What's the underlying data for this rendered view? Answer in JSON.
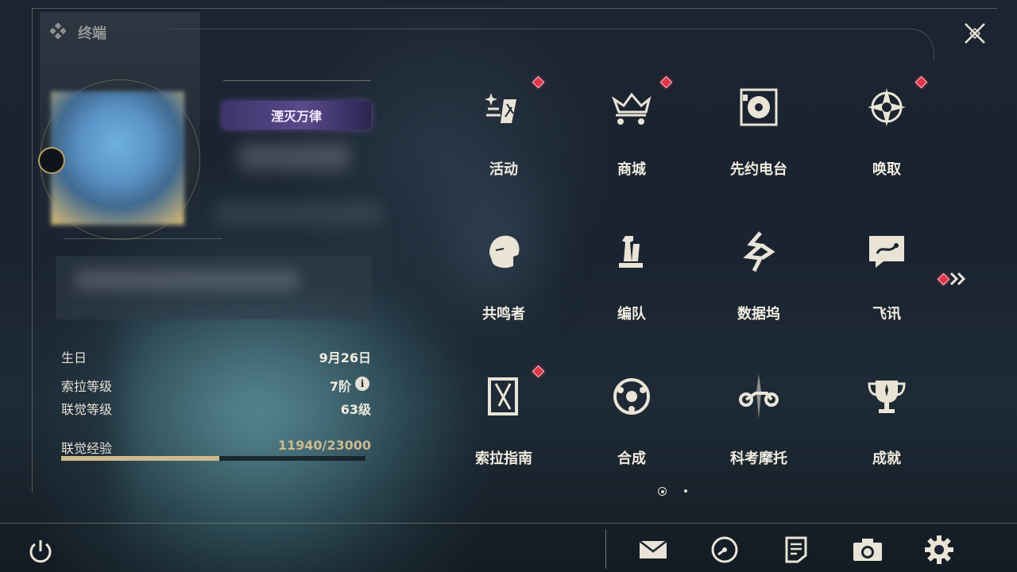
{
  "header": {
    "title": "终端"
  },
  "profile": {
    "title_badge": "湮灭万律"
  },
  "stats": [
    {
      "label": "生日",
      "value": "9月26日"
    },
    {
      "label": "索拉等级",
      "value": "7阶"
    },
    {
      "label": "联觉等级",
      "value": "63级"
    }
  ],
  "experience": {
    "label": "联觉经验",
    "value": "11940/23000",
    "progress": 0.519
  },
  "menu": [
    {
      "label": "活动",
      "icon": "activity-icon",
      "notify": true
    },
    {
      "label": "商城",
      "icon": "shop-crown-cart-icon",
      "notify": true
    },
    {
      "label": "先约电台",
      "icon": "radio-vinyl-icon",
      "notify": false
    },
    {
      "label": "唤取",
      "icon": "compass-star-icon",
      "notify": true
    },
    {
      "label": "共鸣者",
      "icon": "resonator-portrait-icon",
      "notify": false
    },
    {
      "label": "编队",
      "icon": "chess-team-icon",
      "notify": false
    },
    {
      "label": "数据坞",
      "icon": "data-bank-icon",
      "notify": false
    },
    {
      "label": "飞讯",
      "icon": "chat-bubble-icon",
      "notify": false
    },
    {
      "label": "索拉指南",
      "icon": "guidebook-icon",
      "notify": true
    },
    {
      "label": "合成",
      "icon": "synthesis-icon",
      "notify": false
    },
    {
      "label": "科考摩托",
      "icon": "motorcycle-icon",
      "notify": false
    },
    {
      "label": "成就",
      "icon": "trophy-icon",
      "notify": false
    }
  ],
  "pagination": {
    "current": 1,
    "total": 2
  },
  "bottom_bar": [
    "mail-icon",
    "time-icon",
    "notes-icon",
    "camera-icon",
    "settings-gear-icon"
  ],
  "colors": {
    "accent_gold": "#cdb98d",
    "notify_red": "#e1344a",
    "text": "#f1ecdf"
  }
}
